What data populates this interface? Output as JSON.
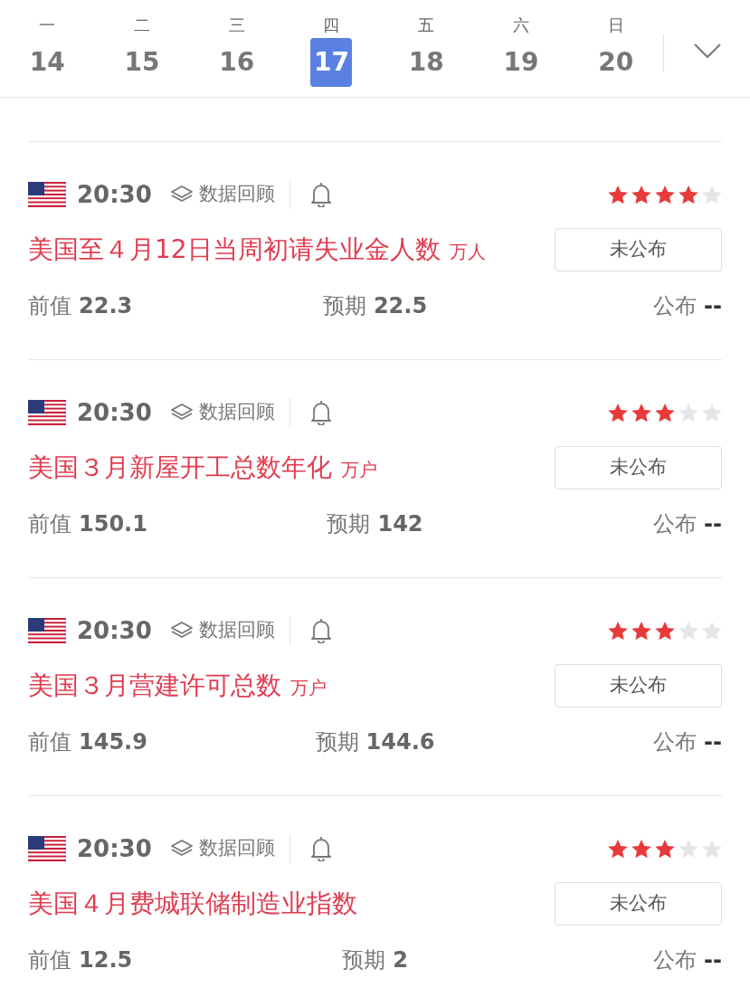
{
  "days": [
    {
      "weekday": "一",
      "date": "14",
      "selected": false
    },
    {
      "weekday": "二",
      "date": "15",
      "selected": false
    },
    {
      "weekday": "三",
      "date": "16",
      "selected": false
    },
    {
      "weekday": "四",
      "date": "17",
      "selected": true
    },
    {
      "weekday": "五",
      "date": "18",
      "selected": false
    },
    {
      "weekday": "六",
      "date": "19",
      "selected": false
    },
    {
      "weekday": "日",
      "date": "20",
      "selected": false
    }
  ],
  "events": [
    {
      "time": "20:30",
      "review": "数据回顾",
      "stars": 4,
      "title": "美国至４月12日当周初请失业金人数",
      "unit": "万人",
      "status": "未公布",
      "previous_label": "前值",
      "previous": "22.3",
      "forecast_label": "预期",
      "forecast": "22.5",
      "actual_label": "公布",
      "actual": "--"
    },
    {
      "time": "20:30",
      "review": "数据回顾",
      "stars": 3,
      "title": "美国３月新屋开工总数年化",
      "unit": "万户",
      "status": "未公布",
      "previous_label": "前值",
      "previous": "150.1",
      "forecast_label": "预期",
      "forecast": "142",
      "actual_label": "公布",
      "actual": "--"
    },
    {
      "time": "20:30",
      "review": "数据回顾",
      "stars": 3,
      "title": "美国３月营建许可总数",
      "unit": "万户",
      "status": "未公布",
      "previous_label": "前值",
      "previous": "145.9",
      "forecast_label": "预期",
      "forecast": "144.6",
      "actual_label": "公布",
      "actual": "--"
    },
    {
      "time": "20:30",
      "review": "数据回顾",
      "stars": 3,
      "title": "美国４月费城联储制造业指数",
      "status": "未公布",
      "previous_label": "前值",
      "previous": "12.5",
      "forecast_label": "预期",
      "forecast": "2",
      "actual_label": "公布",
      "actual": "--"
    }
  ]
}
